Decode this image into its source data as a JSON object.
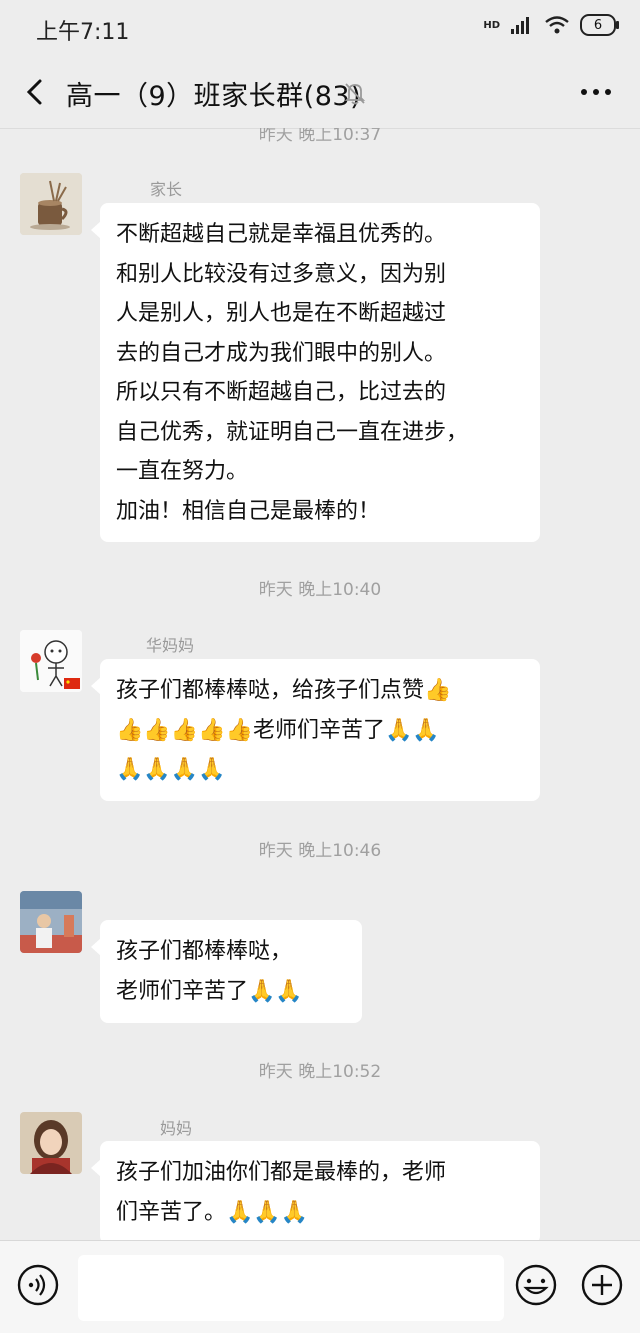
{
  "status_bar": {
    "time": "上午7:11",
    "network": "HD",
    "battery": "6"
  },
  "header": {
    "title": "高一（9）班家长群(83)"
  },
  "chat": {
    "timestamps": [
      "昨天 晚上10:37",
      "昨天 晚上10:40",
      "昨天 晚上10:46",
      "昨天 晚上10:52"
    ],
    "messages": [
      {
        "sender": "家长",
        "lines": [
          "不断超越自己就是幸福且优秀的。",
          "和别人比较没有过多意义，因为别",
          "人是别人，别人也是在不断超越过",
          "去的自己才成为我们眼中的别人。",
          "所以只有不断超越自己，比过去的",
          "自己优秀，就证明自己一直在进步，",
          "一直在努力。",
          "加油！相信自己是最棒的！"
        ]
      },
      {
        "sender": "华妈妈",
        "lines": [
          "孩子们都棒棒哒，给孩子们点赞👍",
          "👍👍👍👍👍老师们辛苦了🙏🙏",
          "🙏🙏🙏🙏"
        ]
      },
      {
        "sender": "",
        "lines": [
          "孩子们都棒棒哒，",
          "老师们辛苦了🙏🙏"
        ]
      },
      {
        "sender": "妈妈",
        "lines": [
          "孩子们加油你们都是最棒的，老师",
          "们辛苦了。🙏🙏🙏"
        ]
      }
    ]
  },
  "input_bar": {
    "placeholder": ""
  },
  "icons": {
    "back": "chevron-left-icon",
    "mute": "bell-off-icon",
    "more": "more-icon",
    "voice": "voice-icon",
    "emoji": "emoji-icon",
    "plus": "plus-icon"
  }
}
